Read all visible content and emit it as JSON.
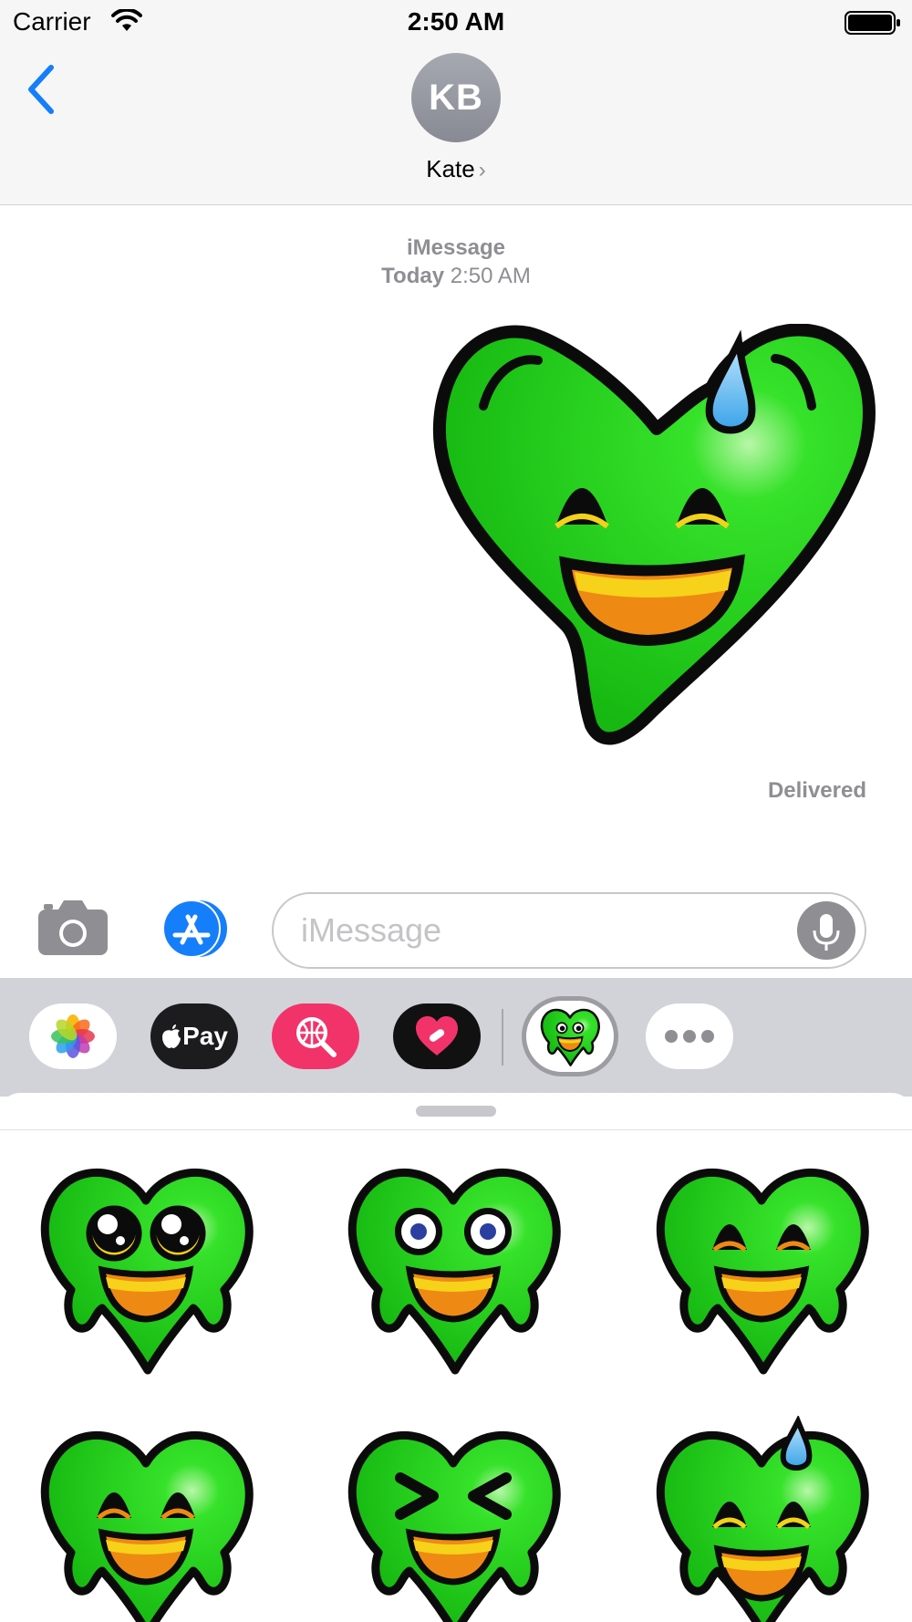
{
  "status_bar": {
    "carrier": "Carrier",
    "time": "2:50 AM"
  },
  "header": {
    "avatar_initials": "KB",
    "contact_name": "Kate",
    "contact_chevron": "›"
  },
  "conversation": {
    "service": "iMessage",
    "timestamp_day": "Today",
    "timestamp_time": "2:50 AM",
    "status": "Delivered"
  },
  "composer": {
    "placeholder": "iMessage"
  },
  "app_drawer": {
    "pay_label": "Pay"
  },
  "colors": {
    "ios_blue": "#157efb",
    "heart_green": "#19d414",
    "outline": "#0b0b0b",
    "drawer_bg": "#d2d3d9"
  }
}
